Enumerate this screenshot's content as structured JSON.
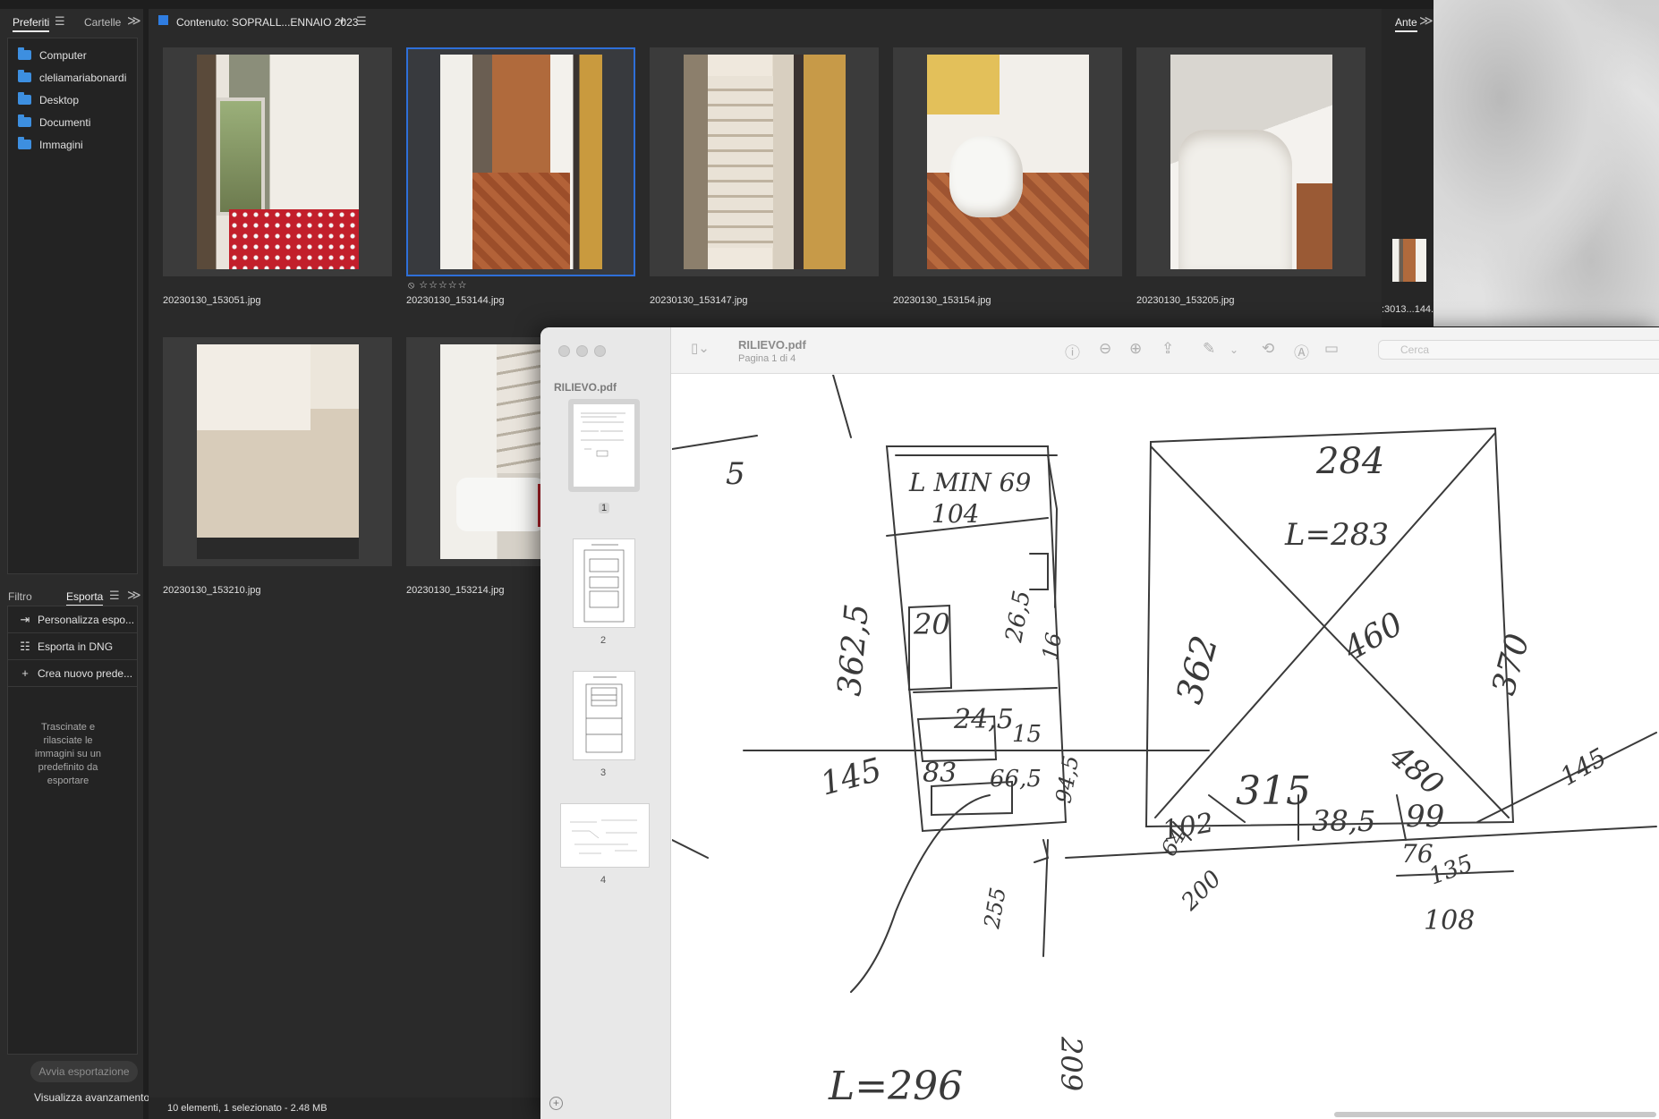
{
  "left_panel": {
    "tabs": {
      "favorites": "Preferiti",
      "folders": "Cartelle"
    },
    "favorites": [
      "Computer",
      "cleliamariabonardi",
      "Desktop",
      "Documenti",
      "Immagini"
    ],
    "export_tabs": {
      "filter": "Filtro",
      "export": "Esporta"
    },
    "export_items": [
      {
        "icon": "export-custom-icon",
        "label": "Personalizza espo..."
      },
      {
        "icon": "list-icon",
        "label": "Esporta in DNG"
      },
      {
        "icon": "plus-icon",
        "label": "Crea nuovo prede..."
      }
    ],
    "drop_hint": "Trascinate e rilasciate le immagini su un predefinito da esportare",
    "start_export": "Avvia esportazione",
    "view_progress": "Visualizza avanzamento"
  },
  "content": {
    "title": "Contenuto: SOPRALL...ENNAIO 2023",
    "thumbnails": [
      {
        "file": "20230130_153051.jpg",
        "selected": false
      },
      {
        "file": "20230130_153144.jpg",
        "selected": true,
        "rating": "⦸ ☆☆☆☆☆"
      },
      {
        "file": "20230130_153147.jpg",
        "selected": false
      },
      {
        "file": "20230130_153154.jpg",
        "selected": false
      },
      {
        "file": "20230130_153205.jpg",
        "selected": false
      },
      {
        "file": "20230130_153210.jpg",
        "selected": false
      },
      {
        "file": "20230130_153214.jpg",
        "selected": false
      }
    ],
    "status": "10 elementi, 1 selezionato - 2.48 MB"
  },
  "preview_panel": {
    "tab": "Ante",
    "label": ":3013...144."
  },
  "preview_app": {
    "doc_title": "RILIEVO.pdf",
    "doc_subtitle": "Pagina 1 di 4",
    "sidebar_title": "RILIEVO.pdf",
    "pages": [
      "1",
      "2",
      "3",
      "4"
    ],
    "search_placeholder": "Cerca"
  },
  "sketch": {
    "notes": [
      "5",
      "L MIN 69",
      "104",
      "284",
      "L=283",
      "362,5",
      "20",
      "26,5",
      "16",
      "362",
      "460",
      "370",
      "24,5",
      "15",
      "145",
      "83",
      "66,5",
      "480",
      "315",
      "102",
      "99",
      "38,5",
      "76",
      "135",
      "64",
      "200",
      "108",
      "255",
      "94,5",
      "209",
      "L=296",
      "145"
    ]
  },
  "colors": {
    "accent": "#2f7de1",
    "panel": "#2b2b2b",
    "selection": "#2e6fd8"
  }
}
